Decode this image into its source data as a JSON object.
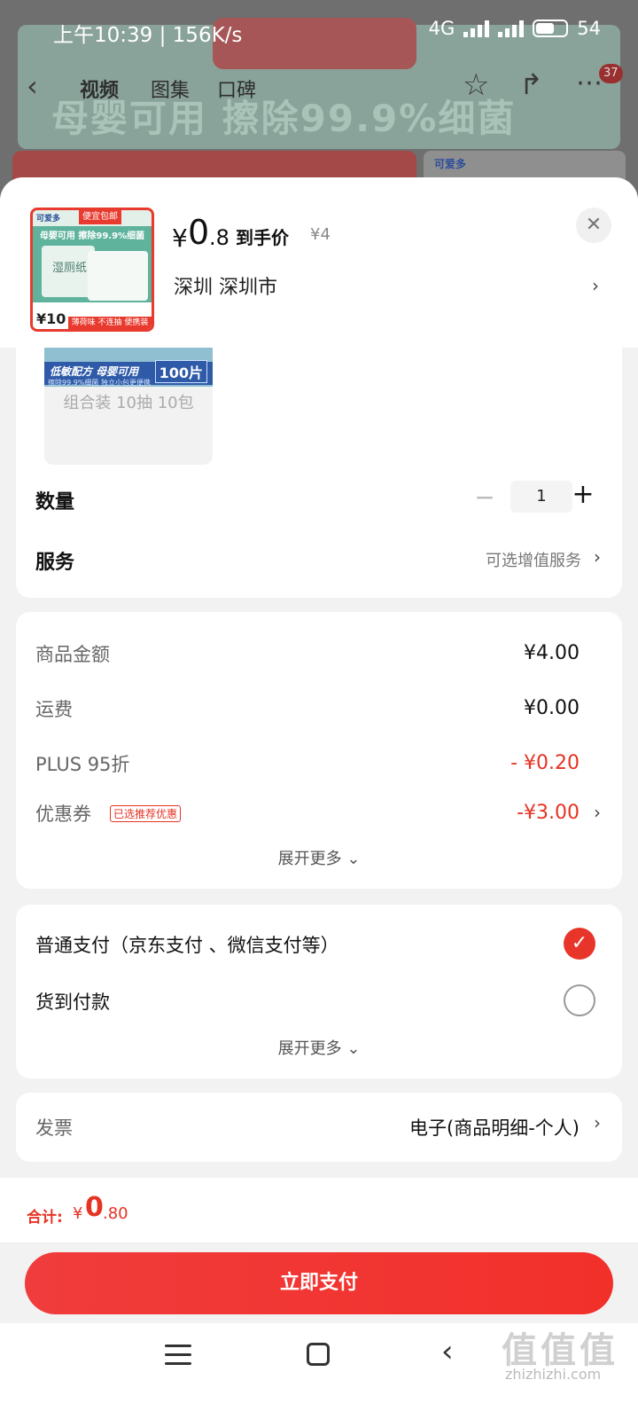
{
  "status_bar": {
    "time": "上午10:39",
    "speed": "156K/s",
    "network": "4G",
    "battery": "54"
  },
  "background_page": {
    "banner_text": "母婴可用 擦除99.9%细菌",
    "tabs": [
      "视频",
      "图集",
      "口碑"
    ],
    "cart_count": "37",
    "brand": "可爱多"
  },
  "product": {
    "thumbnail": {
      "brand": "可爱多",
      "tag": "便宜包邮",
      "headline": "母婴可用 擦除99.9%细菌",
      "pack_word": "湿厕纸",
      "price": "¥10",
      "promo": "薄荷味 不连抽 便携装"
    },
    "price_currency": "¥",
    "price_int": "0",
    "price_dec": ".8",
    "price_label": "到手价",
    "original_price": "¥4",
    "location": "深圳 深圳市"
  },
  "variant": {
    "img_text": "低敏配方 母婴可用",
    "img_sub": "擦除99.9%细菌 独立小包更便携",
    "img_count": "100片",
    "label": "组合装 10抽 10包"
  },
  "quantity": {
    "label": "数量",
    "value": "1",
    "minus": "−",
    "plus": "+"
  },
  "service": {
    "label": "服务",
    "value": "可选增值服务"
  },
  "fees": {
    "goods_label": "商品金额",
    "goods_value": "¥4.00",
    "shipping_label": "运费",
    "shipping_value": "¥0.00",
    "plus_label": "PLUS 95折",
    "plus_value": "- ¥0.20",
    "coupon_label": "优惠券",
    "coupon_tag": "已选推荐优惠",
    "coupon_value": "-¥3.00",
    "more": "展开更多 ⌄"
  },
  "payment": {
    "option1": "普通支付（京东支付 、微信支付等）",
    "option2": "货到付款",
    "more": "展开更多 ⌄"
  },
  "invoice": {
    "label": "发票",
    "value": "电子(商品明细-个人)"
  },
  "total": {
    "label": "合计:",
    "currency": "¥",
    "int": "0",
    "dec": ".80"
  },
  "pay_button": "立即支付",
  "watermark": {
    "mark": "值值值",
    "text": "zhizhizhi.com"
  },
  "colors": {
    "accent": "#e8352a",
    "price_red": "#e63323"
  }
}
